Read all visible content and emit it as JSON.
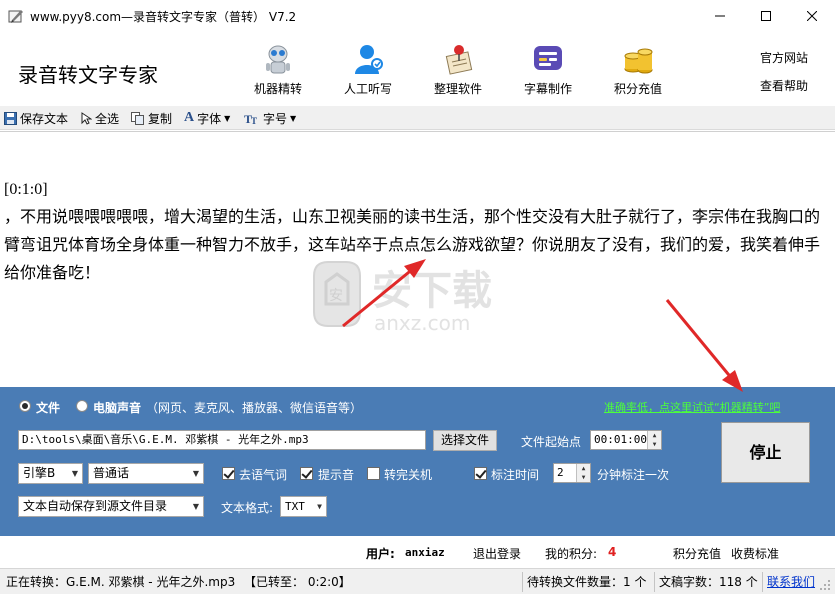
{
  "window": {
    "title": "www.pyy8.com—录音转文字专家（普转） V7.2",
    "minimize_icon": "minimize-icon",
    "maximize_icon": "maximize-icon",
    "close_icon": "close-icon"
  },
  "header": {
    "app_name": "录音转文字专家",
    "nav": [
      {
        "label": "机器精转",
        "icon": "robot-icon"
      },
      {
        "label": "人工听写",
        "icon": "person-icon"
      },
      {
        "label": "整理软件",
        "icon": "pin-notebook-icon"
      },
      {
        "label": "字幕制作",
        "icon": "subtitle-icon"
      },
      {
        "label": "积分充值",
        "icon": "coins-icon"
      }
    ],
    "links": [
      "官方网站",
      "查看帮助"
    ]
  },
  "toolbar": {
    "save": "保存文本",
    "select_all": "全选",
    "copy": "复制",
    "font": "字体",
    "font_size": "字号"
  },
  "editor": {
    "timestamp": "[0:1:0]",
    "body": "，不用说喂喂喂喂喂，增大渴望的生活，山东卫视美丽的读书生活，那个性交没有大肚子就行了，李宗伟在我胸口的臂弯诅咒体育场全身体重一种智力不放手，这车站卒于点点怎么游戏欲望？你说朋友了没有，我们的爱，我笑着伸手给你准备吃！",
    "watermark_text": "安下载",
    "watermark_url": "anxz.com"
  },
  "panel": {
    "source_file": "文件",
    "source_pc": "电脑声音",
    "source_pc_hint": "（网页、麦克风、播放器、微信语音等）",
    "accuracy_link": "准确率低，点这里试试“机器精转”吧",
    "file_path": "D:\\tools\\桌面\\音乐\\G.E.M. 邓紫棋 - 光年之外.mp3",
    "choose_file": "选择文件",
    "start_point_label": "文件起始点",
    "start_point_value": "00:01:00",
    "engine": "引擎B",
    "language": "普通话",
    "remove_filler": "去语气词",
    "prompt_sound": "提示音",
    "shutdown": "转完关机",
    "mark_time": "标注时间",
    "mark_interval": "2",
    "mark_suffix": "分钟标注一次",
    "autosave": "文本自动保存到源文件目录",
    "format_label": "文本格式:",
    "format_value": "TXT",
    "stop": "停止"
  },
  "user_row": {
    "user_label": "用户:",
    "user_name": "anxiaz",
    "logout": "退出登录",
    "points_label": "我的积分:",
    "points_value": "4",
    "recharge": "积分充值",
    "pricing": "收费标准"
  },
  "status": {
    "converting": "正在转换：G.E.M. 邓紫棋 - 光年之外.mp3",
    "progress": "【已转至： 0:2:0】",
    "pending": "待转换文件数量：1 个",
    "char_count": "文稿字数：118 个",
    "contact": "联系我们"
  },
  "colors": {
    "panel_bg": "#4a7cb5",
    "link_green": "#4cff3a",
    "points_red": "#e02020",
    "annotation_red": "#e02828"
  }
}
